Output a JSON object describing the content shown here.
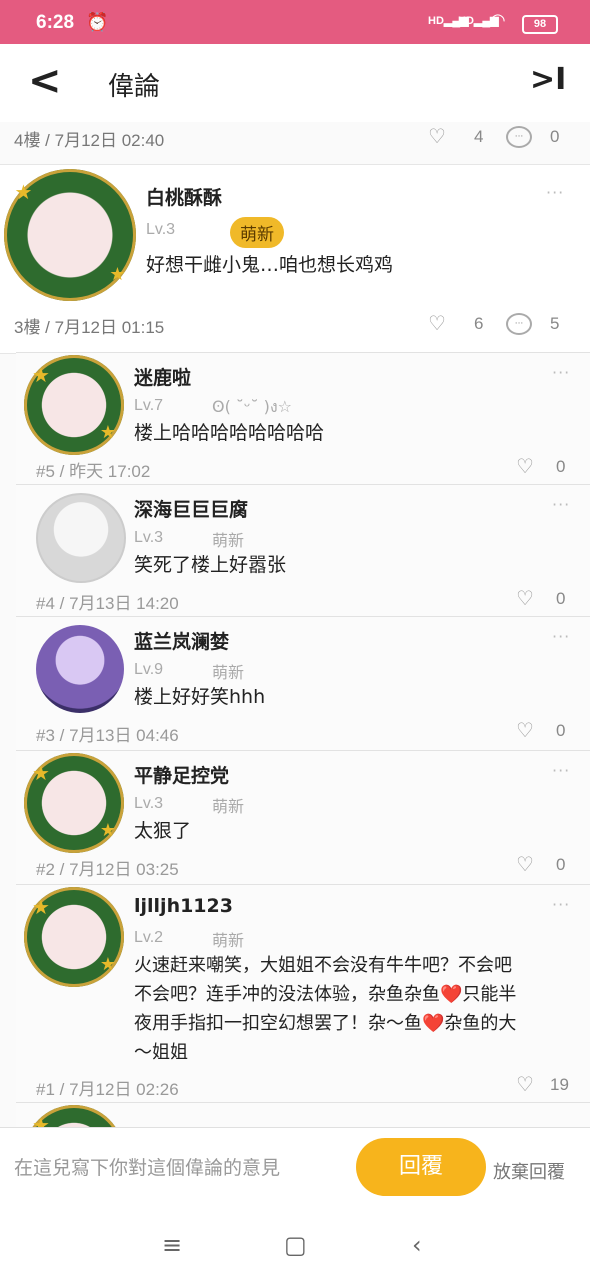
{
  "status_bar": {
    "time": "6:28",
    "battery": "98"
  },
  "header": {
    "back_label": "<",
    "title": "偉論",
    "last_label": ">I"
  },
  "prev_post": {
    "meta": "4樓 / 7月12日 02:40",
    "likes": "4",
    "comments": "0"
  },
  "main_post": {
    "username": "白桃酥酥",
    "level": "Lv.3",
    "badge": "萌新",
    "text": "好想干雌小鬼…咱也想长鸡鸡",
    "meta": "3樓 / 7月12日 01:15",
    "likes": "6",
    "comments": "5"
  },
  "replies": [
    {
      "username": "迷鹿啦",
      "level": "Lv.7",
      "badge": "ʘ( ˘ᵕ˘ )ง☆",
      "text": "楼上哈哈哈哈哈哈哈哈",
      "meta": "#5 / 昨天 17:02",
      "likes": "0"
    },
    {
      "username": "深海巨巨巨腐",
      "level": "Lv.3",
      "badge": "萌新",
      "text": "笑死了楼上好嚣张",
      "meta": "#4 / 7月13日 14:20",
      "likes": "0"
    },
    {
      "username": "蓝兰岚澜婪",
      "level": "Lv.9",
      "badge": "萌新",
      "text": "楼上好好笑hhh",
      "meta": "#3 / 7月13日 04:46",
      "likes": "0"
    },
    {
      "username": "平静足控党",
      "level": "Lv.3",
      "badge": "萌新",
      "text": "太狠了",
      "meta": "#2 / 7月12日 03:25",
      "likes": "0"
    },
    {
      "username": "ljlljh1123",
      "level": "Lv.2",
      "badge": "萌新",
      "text_lines": [
        "火速赶来嘲笑，大姐姐不会没有牛牛吧？不会吧",
        "不会吧？连手冲的没法体验，杂鱼杂鱼❤️只能半",
        "夜用手指扣一扣空幻想罢了！杂～鱼❤️杂鱼的大",
        "～姐姐"
      ],
      "meta": "#1 / 7月12日 02:26",
      "likes": "19"
    }
  ],
  "footer": {
    "placeholder": "在這兒寫下你對這個偉論的意見",
    "reply_button": "回覆",
    "abandon": "放棄回覆"
  },
  "nav": {
    "menu": "≡",
    "home": "▢",
    "back": "‹"
  },
  "colors": {
    "status_bar": "#e45b80",
    "accent": "#f7b41c",
    "badge": "#f0b929"
  }
}
